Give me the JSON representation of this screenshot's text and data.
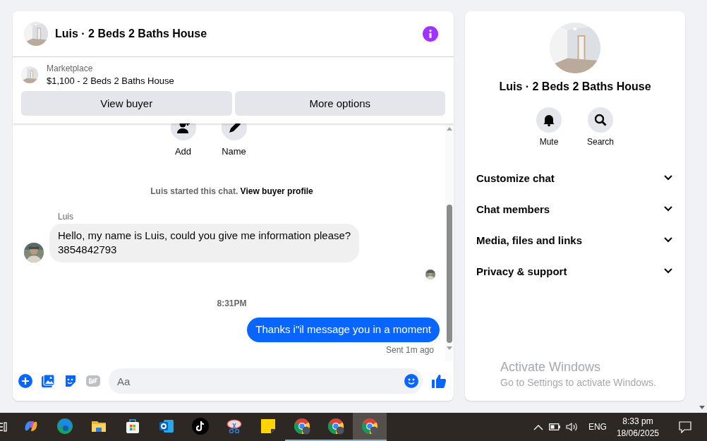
{
  "chat": {
    "title": "Luis · 2 Beds 2 Baths House",
    "listing": {
      "source": "Marketplace",
      "title": "$1,100 - 2 Beds 2 Baths House"
    },
    "buttons": [
      "View buyer",
      "More options"
    ],
    "quick_actions": [
      {
        "kind": "add",
        "label": "Add"
      },
      {
        "kind": "name",
        "label": "Name"
      }
    ],
    "system_note": {
      "text": "Luis started this chat.",
      "link": "View buyer profile"
    },
    "messages": [
      {
        "kind": "incoming",
        "sender": "Luis",
        "text": "Hello, my name is Luis, could you give me information please?\n3854842793"
      },
      {
        "kind": "seen"
      },
      {
        "kind": "timestamp",
        "text": "8:31PM"
      },
      {
        "kind": "outgoing",
        "text": "Thanks i\"il message you in a moment",
        "status": "Sent 1m ago"
      }
    ],
    "composer": {
      "placeholder": "Aa"
    }
  },
  "details": {
    "title": "Luis · 2 Beds 2 Baths House",
    "actions": [
      {
        "kind": "bell",
        "label": "Mute"
      },
      {
        "kind": "search",
        "label": "Search"
      }
    ],
    "sections": [
      {
        "label": "Customize chat",
        "expanded": false
      },
      {
        "label": "Chat members",
        "expanded": false
      },
      {
        "label": "Media, files and links",
        "expanded": false
      },
      {
        "label": "Privacy & support",
        "expanded": false
      }
    ]
  },
  "activation_notice": {
    "title": "Activate Windows",
    "subtitle": "Go to Settings to activate Windows."
  },
  "taskbar": {
    "apps": [
      {
        "kind": "copilot",
        "running": false,
        "selected": false
      },
      {
        "kind": "edge",
        "running": false,
        "selected": false
      },
      {
        "kind": "explorer",
        "running": false,
        "selected": false
      },
      {
        "kind": "store",
        "running": false,
        "selected": false
      },
      {
        "kind": "outlook",
        "running": false,
        "selected": false
      },
      {
        "kind": "tiktok",
        "running": false,
        "selected": false
      },
      {
        "kind": "snip",
        "running": false,
        "selected": false
      },
      {
        "kind": "sticky",
        "running": false,
        "selected": false
      },
      {
        "kind": "chrome",
        "running": true,
        "selected": false
      },
      {
        "kind": "chrome",
        "running": true,
        "selected": false
      },
      {
        "kind": "chrome",
        "running": true,
        "selected": true
      }
    ],
    "tray": {
      "language": "ENG",
      "time": "8:33 pm",
      "date": "18/06/2025"
    }
  }
}
